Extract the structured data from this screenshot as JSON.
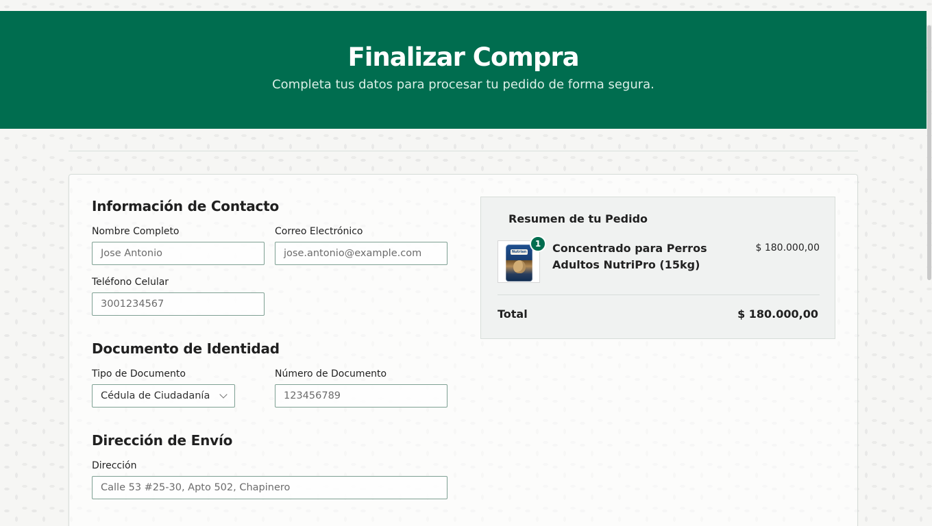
{
  "header": {
    "title": "Finalizar Compra",
    "subtitle": "Completa tus datos para procesar tu pedido de forma segura."
  },
  "contact": {
    "title": "Información de Contacto",
    "full_name_label": "Nombre Completo",
    "full_name_value": "Jose Antonio",
    "email_label": "Correo Electrónico",
    "email_value": "jose.antonio@example.com",
    "phone_label": "Teléfono Celular",
    "phone_value": "3001234567"
  },
  "identity": {
    "title": "Documento de Identidad",
    "document_type_label": "Tipo de Documento",
    "document_type_selected": "Cédula de Ciudadanía",
    "document_number_label": "Número de Documento",
    "document_number_value": "123456789"
  },
  "shipping": {
    "title": "Dirección de Envío",
    "address_label": "Dirección",
    "address_value": "Calle 53 #25-30, Apto 502, Chapinero"
  },
  "summary": {
    "title": "Resumen de tu Pedido",
    "item": {
      "quantity": "1",
      "name": "Concentrado para Perros Adultos NutriPro (15kg)",
      "price": "$ 180.000,00",
      "image_text": "Nutrian"
    },
    "total_label": "Total",
    "total_value": "$ 180.000,00"
  },
  "colors": {
    "brand_green": "#006d4f",
    "input_border": "#7d9f92",
    "summary_background": "#eff1f0"
  },
  "icons": {
    "select": "chevron-down-icon"
  }
}
